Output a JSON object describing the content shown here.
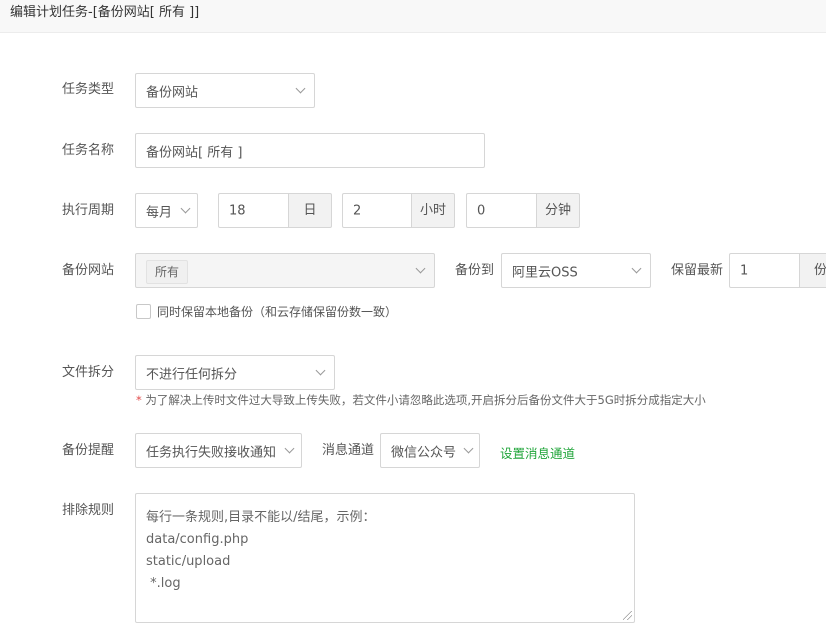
{
  "header": {
    "title": "编辑计划任务-[备份网站[ 所有 ]]"
  },
  "form": {
    "task_type": {
      "label": "任务类型",
      "value": "备份网站"
    },
    "task_name": {
      "label": "任务名称",
      "value": "备份网站[ 所有 ]"
    },
    "cycle": {
      "label": "执行周期",
      "period": "每月",
      "day": "18",
      "day_unit": "日",
      "hour": "2",
      "hour_unit": "小时",
      "minute": "0",
      "minute_unit": "分钟"
    },
    "backup_site": {
      "label": "备份网站",
      "tag": "所有",
      "target_label": "备份到",
      "target": "阿里云OSS",
      "keep_label": "保留最新",
      "keep_value": "1",
      "keep_unit": "份",
      "local_checkbox_label": "同时保留本地备份（和云存储保留份数一致）",
      "local_checked": false
    },
    "split": {
      "label": "文件拆分",
      "value": "不进行任何拆分",
      "note_star": "*",
      "note": "为了解决上传时文件过大导致上传失败，若文件小请忽略此选项,开启拆分后备份文件大于5G时拆分成指定大小"
    },
    "notify": {
      "label": "备份提醒",
      "value": "任务执行失败接收通知",
      "channel_label": "消息通道",
      "channel": "微信公众号",
      "setup_link": "设置消息通道"
    },
    "exclude": {
      "label": "排除规则",
      "lines": [
        "每行一条规则,目录不能以/结尾，示例：",
        "data/config.php",
        "static/upload",
        " *.log"
      ]
    }
  }
}
